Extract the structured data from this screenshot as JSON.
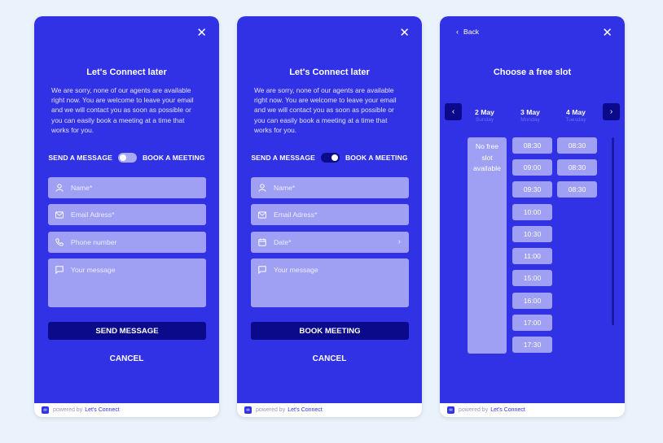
{
  "footer": {
    "powered": "powered by",
    "brand": "Let's Connect"
  },
  "close_glyph": "✕",
  "panel1": {
    "title": "Let's Connect later",
    "description": "We are sorry, none of our agents are available right now. You are welcome to leave your email and we will contact you as soon as possible or you can easily book a meeting at a time that works for you.",
    "toggle_left": "SEND A MESSAGE",
    "toggle_right": "BOOK A MEETING",
    "toggle_state": "off",
    "fields": {
      "name": "Name*",
      "email": "Email Adress*",
      "phone": "Phone number",
      "message": "Your message"
    },
    "submit": "SEND MESSAGE",
    "cancel": "CANCEL"
  },
  "panel2": {
    "title": "Let's Connect later",
    "description": "We are sorry, none of our agents are available right now. You are welcome to leave your email and we will contact you as soon as possible or you can easily book a meeting at a time that works for you.",
    "toggle_left": "SEND A MESSAGE",
    "toggle_right": "BOOK A MEETING",
    "toggle_state": "on",
    "fields": {
      "name": "Name*",
      "email": "Email Adress*",
      "date": "Date*",
      "message": "Your message"
    },
    "submit": "BOOK MEETING",
    "cancel": "CANCEL"
  },
  "panel3": {
    "back": "Back",
    "title": "Choose a free slot",
    "days": [
      {
        "date": "2 May",
        "weekday": "Sunday"
      },
      {
        "date": "3 May",
        "weekday": "Monday"
      },
      {
        "date": "4 May",
        "weekday": "Tuesday"
      }
    ],
    "no_slot": [
      "No free",
      "slot",
      "available"
    ],
    "monday_slots": [
      "08:30",
      "09:00",
      "09:30",
      "10:00",
      "10:30",
      "11:00",
      "15:00",
      "16:00",
      "17:00",
      "17:30"
    ],
    "tuesday_slots": [
      "08:30",
      "08:30",
      "08:30"
    ]
  },
  "colors": {
    "accent": "#3131e6",
    "dark": "#0a0a8a",
    "field": "#9f9ff3",
    "background": "#eaf2fb"
  },
  "icons": {
    "name": "user-icon",
    "email": "mail-icon",
    "phone": "phone-icon",
    "message": "chat-icon",
    "date": "calendar-icon",
    "close": "close-icon"
  }
}
